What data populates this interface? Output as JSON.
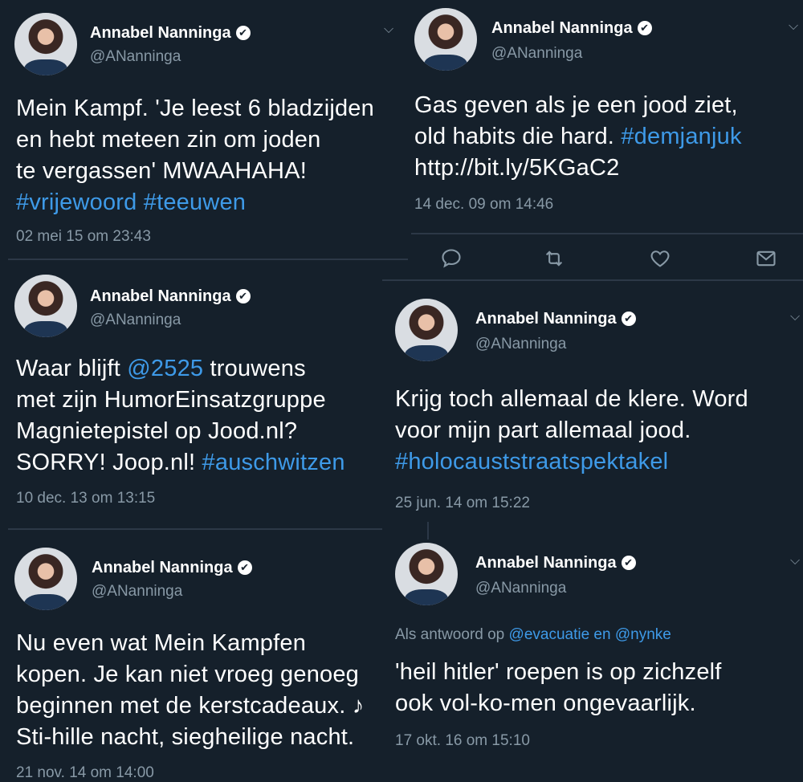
{
  "author": {
    "name": "Annabel Nanninga",
    "handle": "@ANanninga",
    "verified_glyph": "✔"
  },
  "colors": {
    "background": "#15202b",
    "link": "#3e9ae8",
    "secondary_text": "#8899a6",
    "divider": "#2c3847"
  },
  "tweets": [
    {
      "lines": [
        [
          "Mein Kampf. 'Je leest 6 bladzijden"
        ],
        [
          "en hebt meteen zin om joden"
        ],
        [
          "te vergassen' MWAAHAHA!"
        ]
      ],
      "hashtag_line": [
        "#vrijewoord",
        "#teeuwen"
      ],
      "timestamp": "02 mei 15 om 23:43"
    },
    {
      "line1": "Gas geven als je een jood ziet,",
      "line2_text": "old habits die hard. ",
      "line2_link": "#demjanjuk",
      "line3": "http://bit.ly/5KGaC2",
      "timestamp": "14 dec. 09 om 14:46",
      "actions": [
        "reply-icon",
        "retweet-icon",
        "like-icon",
        "message-icon"
      ]
    },
    {
      "line1_text": "Waar blijft ",
      "line1_link": "@2525",
      "line1_after": " trouwens",
      "line2": "met zijn HumorEinsatzgruppe",
      "line3": "Magnietepistel op Jood.nl?",
      "line4_text": "SORRY! Joop.nl! ",
      "line4_link": "#auschwitzen",
      "timestamp": "10 dec. 13 om 13:15"
    },
    {
      "line1": "Krijg toch allemaal de klere. Word",
      "line2": "voor mijn part allemaal jood.",
      "line3_link": "#holocauststraatspektakel",
      "timestamp": "25 jun. 14 om 15:22"
    },
    {
      "line1": "Nu even wat Mein Kampfen",
      "line2": "kopen. Je kan niet vroeg genoeg",
      "line3": "beginnen met de kerstcadeaux. ♪",
      "line4": "Sti-hille nacht, siegheilige nacht.",
      "timestamp": "21 nov. 14 om 14:00"
    },
    {
      "reply_prefix": "Als antwoord op ",
      "reply_users": "@evacuatie en @nynke",
      "line1": "'heil hitler' roepen is op zichzelf",
      "line2": "ook vol-ko-men ongevaarlijk.",
      "timestamp": "17 okt. 16 om 15:10"
    }
  ]
}
